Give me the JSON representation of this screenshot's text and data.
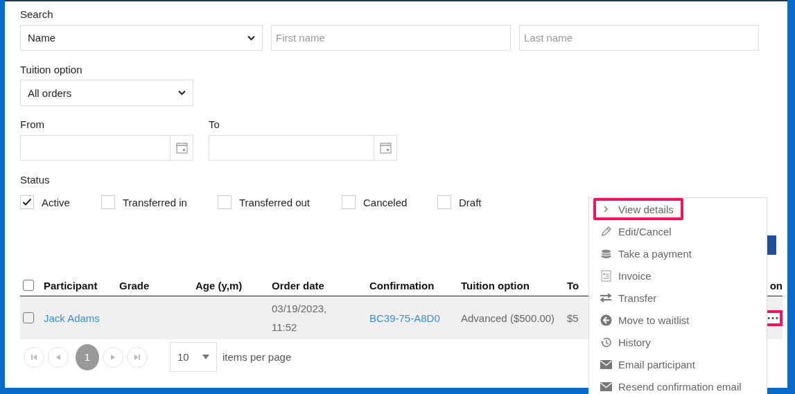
{
  "search": {
    "label": "Search",
    "mode": "Name",
    "first_name": {
      "placeholder": "First name"
    },
    "last_name": {
      "placeholder": "Last name"
    }
  },
  "tuition": {
    "label": "Tuition option",
    "value": "All orders"
  },
  "date_range": {
    "from": {
      "label": "From"
    },
    "to": {
      "label": "To"
    }
  },
  "status": {
    "label": "Status",
    "options": [
      {
        "label": "Active",
        "checked": true
      },
      {
        "label": "Transferred in",
        "checked": false
      },
      {
        "label": "Transferred out",
        "checked": false
      },
      {
        "label": "Canceled",
        "checked": false
      },
      {
        "label": "Draft",
        "checked": false
      }
    ]
  },
  "table": {
    "select_all": {
      "checked": false
    },
    "columns": [
      "Participant",
      "Grade",
      "Age (y,m)",
      "Order date",
      "Confirmation",
      "Tuition option",
      "To",
      "on"
    ],
    "rows": [
      {
        "checked": false,
        "participant": "Jack Adams",
        "order_date": "03/19/2023, 11:52",
        "confirmation": "BC39-75-A8D0",
        "tuition_option": "Advanced ($500.00)",
        "column_7": "$5",
        "more": {
          "label": "•••",
          "highlighted": true
        }
      }
    ]
  },
  "pagination": {
    "pages": [
      {
        "label": "1",
        "selected": true
      }
    ],
    "page_size": "10",
    "page_size_label": "items per page"
  },
  "context_menu": {
    "items": [
      {
        "label": "View details",
        "highlighted": true
      },
      {
        "label": "Edit/Cancel",
        "highlighted": false
      },
      {
        "label": "Take a payment",
        "highlighted": false
      },
      {
        "label": "Invoice",
        "highlighted": false
      },
      {
        "label": "Transfer",
        "highlighted": false
      },
      {
        "label": "Move to waitlist",
        "highlighted": false
      },
      {
        "label": "History",
        "highlighted": false
      },
      {
        "label": "Email participant",
        "highlighted": false
      },
      {
        "label": "Resend confirmation email",
        "highlighted": false
      }
    ]
  }
}
